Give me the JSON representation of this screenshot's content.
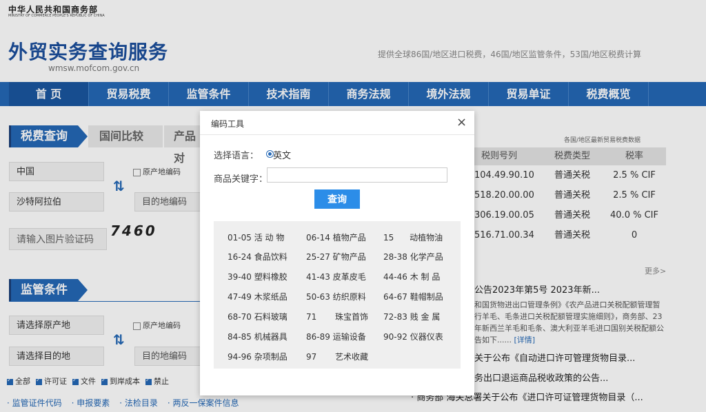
{
  "ministry": {
    "name_cn": "中华人民共和国商务部",
    "name_en": "MINISTRY OF COMMERCE PEOPLE'S REPUBLIC OF CHINA"
  },
  "site": {
    "title": "外贸实务查询服务",
    "url": "wmsw.mofcom.gov.cn",
    "slogan": "提供全球86国/地区进口税费，46国/地区监管条件，53国/地区税费计算"
  },
  "nav": [
    "首 页",
    "贸易税费",
    "监管条件",
    "技术指南",
    "商务法规",
    "境外法规",
    "贸易单证",
    "税费概览"
  ],
  "tariff_panel": {
    "tabs": [
      "税费查询",
      "国间比较",
      "产品对"
    ],
    "origin_value": "中国",
    "origin_code_check": "原产地编码",
    "dest_value": "沙特阿拉伯",
    "dest_code_placeholder": "目的地编码",
    "captcha_placeholder": "请输入图片验证码",
    "captcha_text": "7460"
  },
  "supervision_panel": {
    "title": "监管条件",
    "origin_placeholder": "请选择原产地",
    "origin_code_check": "原产地编码",
    "dest_placeholder": "请选择目的地",
    "dest_code_placeholder": "目的地编码",
    "checkboxes": [
      "全部",
      "许可证",
      "文件",
      "到岸成本",
      "禁止"
    ],
    "links": [
      "· 监管证件代码",
      "· 申报要素",
      "· 法检目录",
      "· 两反一保案件信息"
    ]
  },
  "rates_table": {
    "caption": "各国/地区最新贸易税费数据",
    "headers": [
      "税则号列",
      "税费类型",
      "税率"
    ],
    "rows": [
      [
        "104.49.90.10",
        "普通关税",
        "2.5 % CIF"
      ],
      [
        "518.20.00.00",
        "普通关税",
        "2.5 % CIF"
      ],
      [
        "306.19.00.05",
        "普通关税",
        "40.0 % CIF"
      ],
      [
        "516.71.00.34",
        "普通关税",
        "0"
      ]
    ]
  },
  "news": {
    "more": "更多>",
    "headline": "公告2023年第5号 2023年新...",
    "body": "和国货物进出口管理条例》《农产品进口关税配额管理暂行羊毛、毛条进口关税配额管理实施细则》，商务部、23年新西兰羊毛和毛条、澳大利亚羊毛进口国别关税配额公告如下......",
    "detail": "[详情]",
    "items": [
      "关于公布《自动进口许可管理货物目录...",
      "务出口退运商品税收政策的公告...",
      "· 商务部 海关总署关于公布《进口许可证管理货物目录（..."
    ]
  },
  "modal": {
    "title": "编码工具",
    "close": "×",
    "lang_label": "选择语言：",
    "lang_value": "英文",
    "keyword_label": "商品关键字：",
    "keyword_value": "",
    "query_label": "查询",
    "codes": [
      [
        "01-05",
        "活  动  物"
      ],
      [
        "06-14",
        "植物产品"
      ],
      [
        "15",
        "动植物油"
      ],
      [
        "16-24",
        "食品饮料"
      ],
      [
        "25-27",
        "矿物产品"
      ],
      [
        "28-38",
        "化学产品"
      ],
      [
        "39-40",
        "塑料橡胶"
      ],
      [
        "41-43",
        "皮革皮毛"
      ],
      [
        "44-46",
        "木  制  品"
      ],
      [
        "47-49",
        "木浆纸品"
      ],
      [
        "50-63",
        "纺织原料"
      ],
      [
        "64-67",
        "鞋帽制品"
      ],
      [
        "68-70",
        "石料玻璃"
      ],
      [
        "71",
        "珠宝首饰"
      ],
      [
        "72-83",
        "贱  金  属"
      ],
      [
        "84-85",
        "机械器具"
      ],
      [
        "86-89",
        "运输设备"
      ],
      [
        "90-92",
        "仪器仪表"
      ],
      [
        "94-96",
        "杂项制品"
      ],
      [
        "97",
        "艺术收藏"
      ]
    ]
  },
  "colors": {
    "brand_blue": "#2468b6",
    "button_blue": "#2c8de8",
    "title_blue": "#1b4f9c"
  }
}
